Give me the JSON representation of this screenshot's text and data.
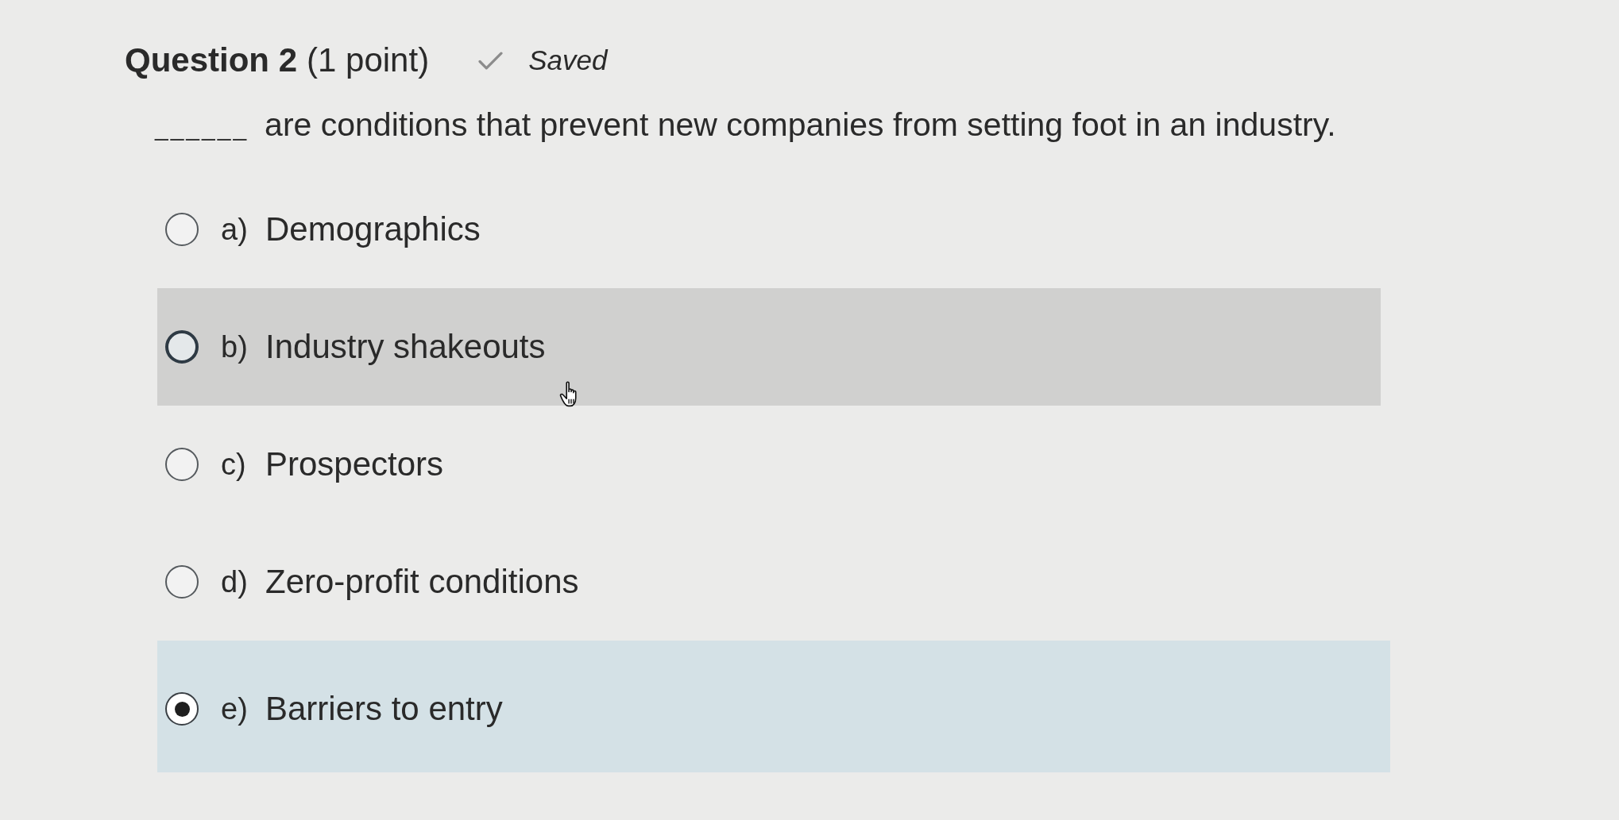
{
  "question": {
    "title": "Question 2",
    "points": "(1 point)",
    "save_status": "Saved",
    "prompt_blank": "______",
    "prompt": "are conditions that prevent new companies from setting foot in an industry."
  },
  "options": [
    {
      "letter": "a)",
      "text": "Demographics",
      "selected": false,
      "hovered": false
    },
    {
      "letter": "b)",
      "text": "Industry shakeouts",
      "selected": false,
      "hovered": true
    },
    {
      "letter": "c)",
      "text": "Prospectors",
      "selected": false,
      "hovered": false
    },
    {
      "letter": "d)",
      "text": "Zero-profit conditions",
      "selected": false,
      "hovered": false
    },
    {
      "letter": "e)",
      "text": "Barriers to entry",
      "selected": true,
      "hovered": false
    }
  ]
}
